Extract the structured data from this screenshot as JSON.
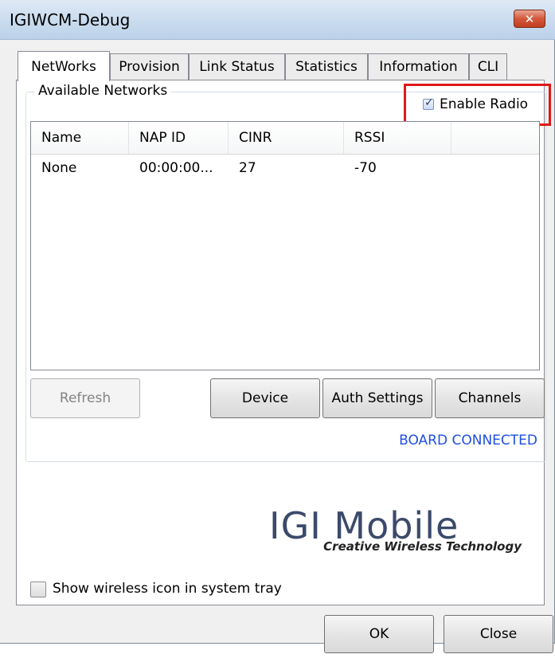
{
  "window": {
    "title": "IGIWCM-Debug",
    "close_glyph": "✕"
  },
  "tabs": [
    {
      "label": "NetWorks"
    },
    {
      "label": "Provision"
    },
    {
      "label": "Link Status"
    },
    {
      "label": "Statistics"
    },
    {
      "label": "Information"
    },
    {
      "label": "CLI"
    }
  ],
  "networks": {
    "group_label": "Available Networks",
    "enable_radio": {
      "label": "Enable Radio",
      "checked": true
    },
    "columns": [
      "Name",
      "NAP ID",
      "CINR",
      "RSSI"
    ],
    "rows": [
      [
        "None",
        "00:00:00...",
        "27",
        "-70"
      ]
    ]
  },
  "buttons": {
    "refresh": "Refresh",
    "device": "Device",
    "auth_settings": "Auth Settings",
    "channels": "Channels",
    "ok": "OK",
    "close": "Close"
  },
  "status": "BOARD CONNECTED",
  "logo": {
    "main": "IGI Mobile",
    "tagline": "Creative Wireless Technology"
  },
  "tray_option": {
    "label": "Show wireless icon in system tray",
    "checked": false
  },
  "colors": {
    "status_text": "#1f4fe0",
    "highlight_box": "#e01818"
  }
}
